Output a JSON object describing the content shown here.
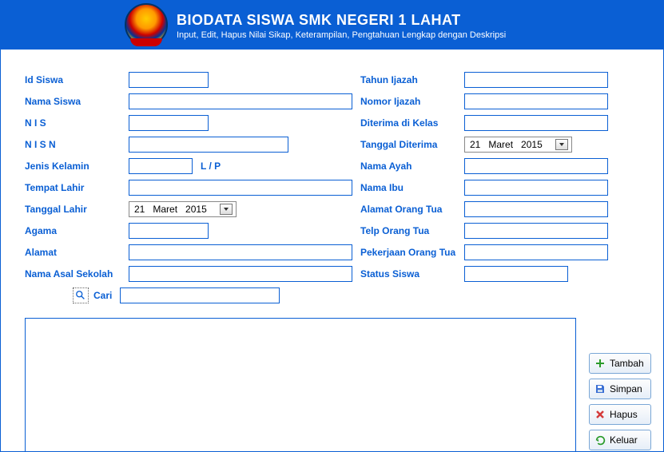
{
  "header": {
    "title": "BIODATA SISWA SMK NEGERI 1 LAHAT",
    "subtitle": "Input, Edit, Hapus Nilai Sikap, Keterampilan, Pengtahuan Lengkap dengan Deskripsi"
  },
  "labels": {
    "id_siswa": "Id Siswa",
    "nama_siswa": "Nama Siswa",
    "nis": "N I S",
    "nisn": "N I S N",
    "jenis_kelamin": "Jenis Kelamin",
    "jk_hint": "L / P",
    "tempat_lahir": "Tempat Lahir",
    "tanggal_lahir": "Tanggal Lahir",
    "agama": "Agama",
    "alamat": "Alamat",
    "nama_asal_sekolah": "Nama Asal Sekolah",
    "tahun_ijazah": "Tahun Ijazah",
    "nomor_ijazah": "Nomor Ijazah",
    "diterima_di_kelas": "Diterima di Kelas",
    "tanggal_diterima": "Tanggal Diterima",
    "nama_ayah": "Nama Ayah",
    "nama_ibu": "Nama Ibu",
    "alamat_ortu": "Alamat Orang Tua",
    "telp_ortu": "Telp Orang Tua",
    "pekerjaan_ortu": "Pekerjaan Orang Tua",
    "status_siswa": "Status Siswa",
    "cari": "Cari"
  },
  "dates": {
    "lahir": {
      "d": "21",
      "m": "Maret",
      "y": "2015"
    },
    "diterima": {
      "d": "21",
      "m": "Maret",
      "y": "2015"
    }
  },
  "buttons": {
    "tambah": "Tambah",
    "simpan": "Simpan",
    "hapus": "Hapus",
    "keluar": "Keluar"
  }
}
